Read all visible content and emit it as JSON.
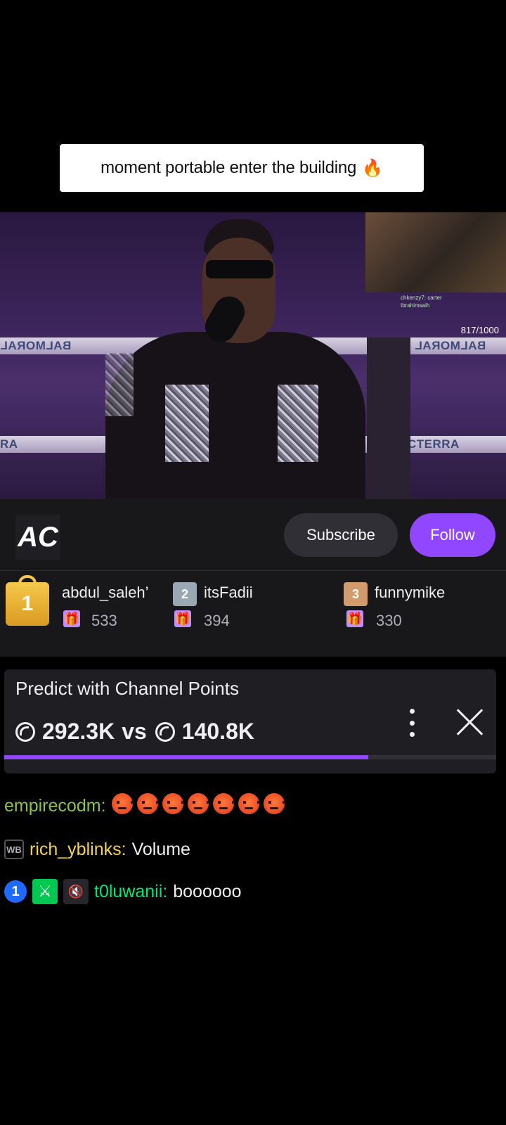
{
  "caption": {
    "text": "moment portable enter the building",
    "emoji": "🔥"
  },
  "video": {
    "viewer_counter": "817/1000",
    "rope_labels": [
      "BALMORAL",
      "BALMORAL",
      "RA",
      "CTERRA"
    ],
    "pip_chat": [
      "chkenzy7: carter",
      "Ibrahimsaih"
    ]
  },
  "channel": {
    "logo_text": "AC",
    "subscribe_label": "Subscribe",
    "follow_label": "Follow"
  },
  "gifters": [
    {
      "rank": "1",
      "name": "abdul_saleh’",
      "count": "533"
    },
    {
      "rank": "2",
      "name": "itsFadii",
      "count": "394"
    },
    {
      "rank": "3",
      "name": "funnymike",
      "count": "330"
    }
  ],
  "prediction": {
    "title": "Predict with Channel Points",
    "left_points": "292.3K",
    "vs_label": "vs",
    "right_points": "140.8K",
    "progress_fraction": 0.74
  },
  "chat": [
    {
      "user": "empirecodm",
      "user_color": "#8bc34a",
      "text": "",
      "emote_count": 7
    },
    {
      "user": "rich_yblinks",
      "user_color": "#f2d34b",
      "text": "Volume",
      "badge": "WB"
    },
    {
      "user": "t0luwanii",
      "user_color": "#00e676",
      "text": "boooooo",
      "badge_sub": "1"
    }
  ],
  "colors": {
    "accent": "#9146ff",
    "panel": "#18181b"
  }
}
